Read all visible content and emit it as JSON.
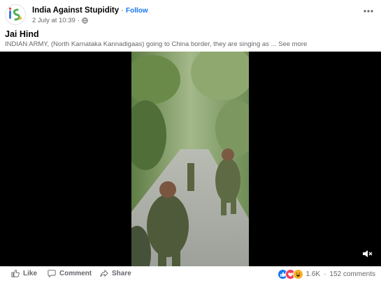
{
  "header": {
    "page_name": "India Against Stupidity",
    "dot": "·",
    "follow_label": "Follow",
    "timestamp": "2 July at 10:39",
    "audience_icon": "globe-icon",
    "more_icon": "more-horizontal-icon"
  },
  "post": {
    "title": "Jai Hind",
    "description": "INDIAN ARMY, (North Karnataka Kannadigaas) going to China border, they are singing as ...",
    "see_more_label": "See more"
  },
  "video": {
    "mute_icon": "speaker-muted-icon"
  },
  "actions": {
    "like_label": "Like",
    "comment_label": "Comment",
    "share_label": "Share"
  },
  "reactions": {
    "types": [
      "like",
      "love",
      "haha"
    ],
    "count": "1.6K",
    "separator": "·",
    "comments": "152 comments"
  },
  "colors": {
    "accent": "#1877f2",
    "secondary_text": "#65676b",
    "love": "#f33e58",
    "haha": "#f7b125"
  }
}
